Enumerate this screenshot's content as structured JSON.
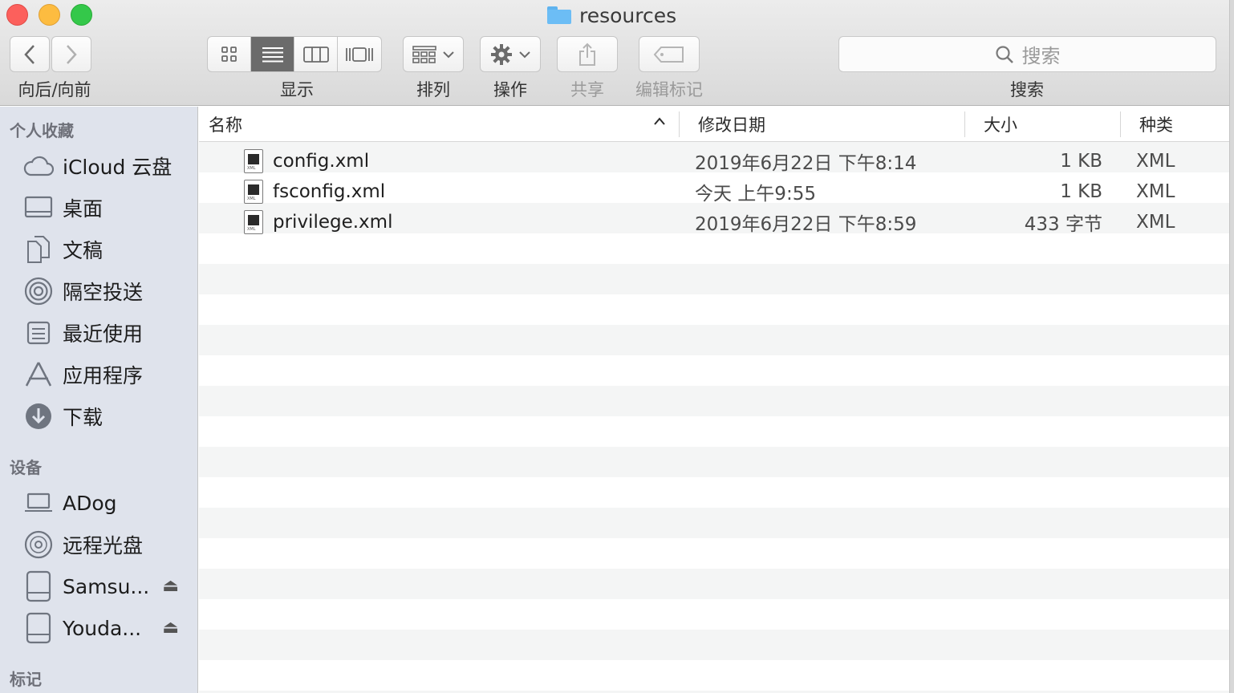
{
  "window": {
    "title": "resources"
  },
  "toolbar": {
    "nav_label": "向后/向前",
    "view_label": "显示",
    "arrange_label": "排列",
    "action_label": "操作",
    "share_label": "共享",
    "tags_label": "编辑标记",
    "search_label": "搜索",
    "search_placeholder": "搜索"
  },
  "sidebar": {
    "favorites_header": "个人收藏",
    "favorites": [
      {
        "label": "iCloud 云盘",
        "icon": "cloud-icon"
      },
      {
        "label": "桌面",
        "icon": "desktop-icon"
      },
      {
        "label": "文稿",
        "icon": "documents-icon"
      },
      {
        "label": "隔空投送",
        "icon": "airdrop-icon"
      },
      {
        "label": "最近使用",
        "icon": "recents-icon"
      },
      {
        "label": "应用程序",
        "icon": "applications-icon"
      },
      {
        "label": "下载",
        "icon": "downloads-icon"
      }
    ],
    "devices_header": "设备",
    "devices": [
      {
        "label": "ADog",
        "icon": "laptop-icon"
      },
      {
        "label": "远程光盘",
        "icon": "disc-icon"
      },
      {
        "label": "Samsu...",
        "icon": "drive-icon",
        "eject": "⏏"
      },
      {
        "label": "Youda...",
        "icon": "drive-icon",
        "eject": "⏏"
      }
    ],
    "tags_header": "标记"
  },
  "columns": {
    "name": "名称",
    "modified": "修改日期",
    "size": "大小",
    "kind": "种类"
  },
  "files": [
    {
      "name": "config.xml",
      "modified": "2019年6月22日 下午8:14",
      "size": "1 KB",
      "kind": "XML"
    },
    {
      "name": "fsconfig.xml",
      "modified": "今天 上午9:55",
      "size": "1 KB",
      "kind": "XML"
    },
    {
      "name": "privilege.xml",
      "modified": "2019年6月22日 下午8:59",
      "size": "433 字节",
      "kind": "XML"
    }
  ]
}
